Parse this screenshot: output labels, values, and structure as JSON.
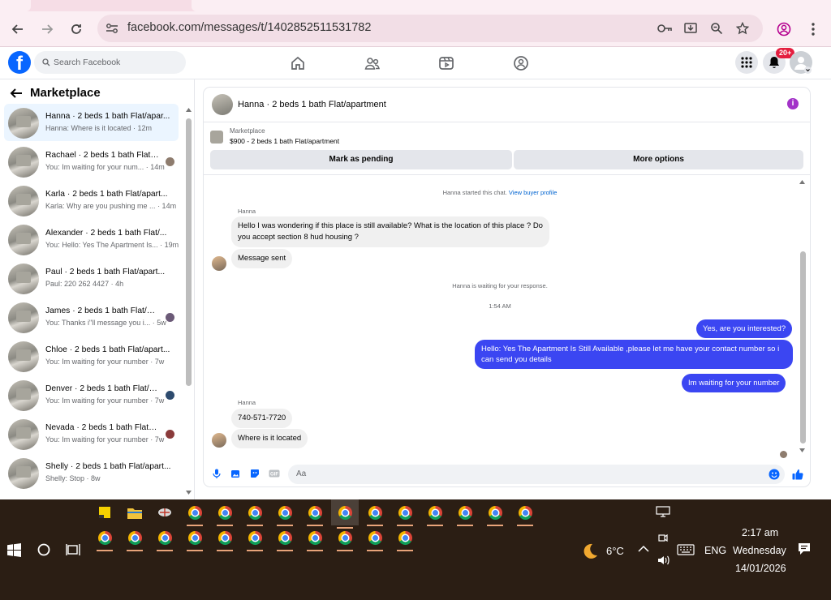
{
  "browser": {
    "url": "facebook.com/messages/t/1402852511531782"
  },
  "fb": {
    "search_placeholder": "Search Facebook",
    "notif_count": "20+"
  },
  "left": {
    "title": "Marketplace",
    "conversations": [
      {
        "name": "Hanna · 2 beds 1 bath Flat/apar...",
        "preview": "Hanna: Where is it located · 12m"
      },
      {
        "name": "Rachael · 2 beds 1 bath Flat/...",
        "preview": "You: Im waiting for your num... · 14m"
      },
      {
        "name": "Karla · 2 beds 1 bath Flat/apart...",
        "preview": "Karla: Why are you pushing me ... · 14m"
      },
      {
        "name": "Alexander · 2 beds 1 bath Flat/...",
        "preview": "You: Hello: Yes The Apartment Is... · 19m"
      },
      {
        "name": "Paul · 2 beds 1 bath Flat/apart...",
        "preview": "Paul: 220 262 4427 · 4h"
      },
      {
        "name": "James · 2 beds 1 bath Flat/ap...",
        "preview": "You: Thanks i\"ll message you i... · 5w"
      },
      {
        "name": "Chloe · 2 beds 1 bath Flat/apart...",
        "preview": "You: Im waiting for your number · 7w"
      },
      {
        "name": "Denver · 2 beds 1 bath Flat/a...",
        "preview": "You: Im waiting for your number · 7w"
      },
      {
        "name": "Nevada · 2 beds 1 bath Flat/a...",
        "preview": "You: Im waiting for your number · 7w"
      },
      {
        "name": "Shelly · 2 beds 1 bath Flat/apart...",
        "preview": "Shelly: Stop · 8w"
      }
    ]
  },
  "chat": {
    "title": "Hanna · 2 beds 1 bath Flat/apartment",
    "listing_label": "Marketplace",
    "listing_price": "$900 - 2 beds 1 bath Flat/apartment",
    "btn_pending": "Mark as pending",
    "btn_more": "More options",
    "started": "Hanna started this chat.",
    "view_profile": "View buyer profile",
    "sender": "Hanna",
    "msg1": "Hello I was wondering if this place is still available? What is the location of this place ? Do you accept section 8 hud housing ?",
    "msg2": "Message sent",
    "waiting": "Hanna is waiting for your response.",
    "time": "1:54 AM",
    "out1": "Yes, are you interested?",
    "out2": "Hello: Yes The Apartment Is Still Available ,please let me have your contact number so i can send you details",
    "out3": "Im waiting for your number",
    "sender2": "Hanna",
    "msg3": "740-571-7720",
    "msg4": "Where is it located",
    "composer_placeholder": "Aa"
  },
  "taskbar": {
    "weather": "6°C",
    "lang": "ENG",
    "time": "2:17 am",
    "day": "Wednesday",
    "date": "14/01/2026"
  }
}
